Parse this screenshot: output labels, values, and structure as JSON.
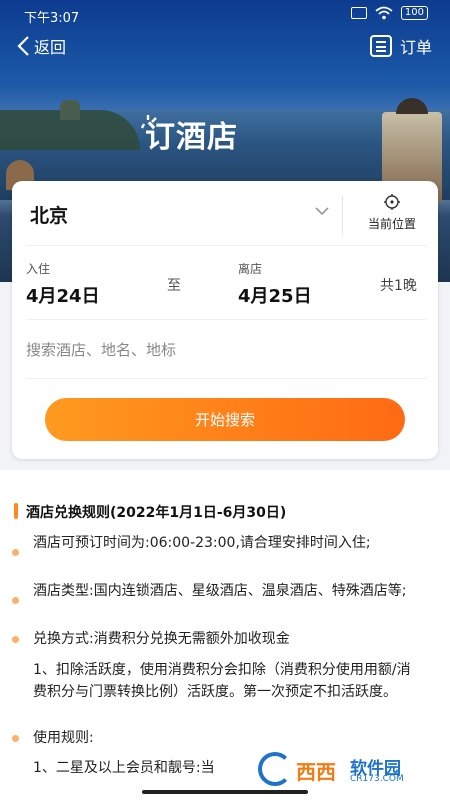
{
  "status_bar": {
    "time": "下午3:07",
    "battery": "100"
  },
  "nav": {
    "back_label": "返回",
    "order_label": "订单"
  },
  "banner": {
    "title": "订酒店"
  },
  "booking": {
    "city": "北京",
    "location_label": "当前位置",
    "checkin_label": "入住",
    "checkin_date": "4月24日",
    "separator": "至",
    "checkout_label": "离店",
    "checkout_date": "4月25日",
    "nights": "共1晚",
    "search_placeholder": "搜索酒店、地名、地标",
    "search_button": "开始搜索"
  },
  "rules": {
    "title": "酒店兑换规则(2022年1月1日-6月30日)",
    "items": [
      "酒店可预订时间为:06:00-23:00,请合理安排时间入住;",
      "酒店类型:国内连锁酒店、星级酒店、温泉酒店、特殊酒店等;",
      "兑换方式:消费积分兑换无需额外加收现金",
      "1、扣除活跃度，使用消费积分会扣除（消费积分使用用额/消费积分与门票转换比例）活跃度。第一次预定不扣活跃度。",
      "使用规则:",
      "1、二星及以上会员和靓号:当"
    ]
  },
  "watermark": {
    "brand": "西西",
    "name": "软件园",
    "url": "CR173.COM"
  },
  "colors": {
    "accent": "#ff7a1a",
    "bullet": "#ffb068",
    "nav_text": "#ffffff"
  }
}
